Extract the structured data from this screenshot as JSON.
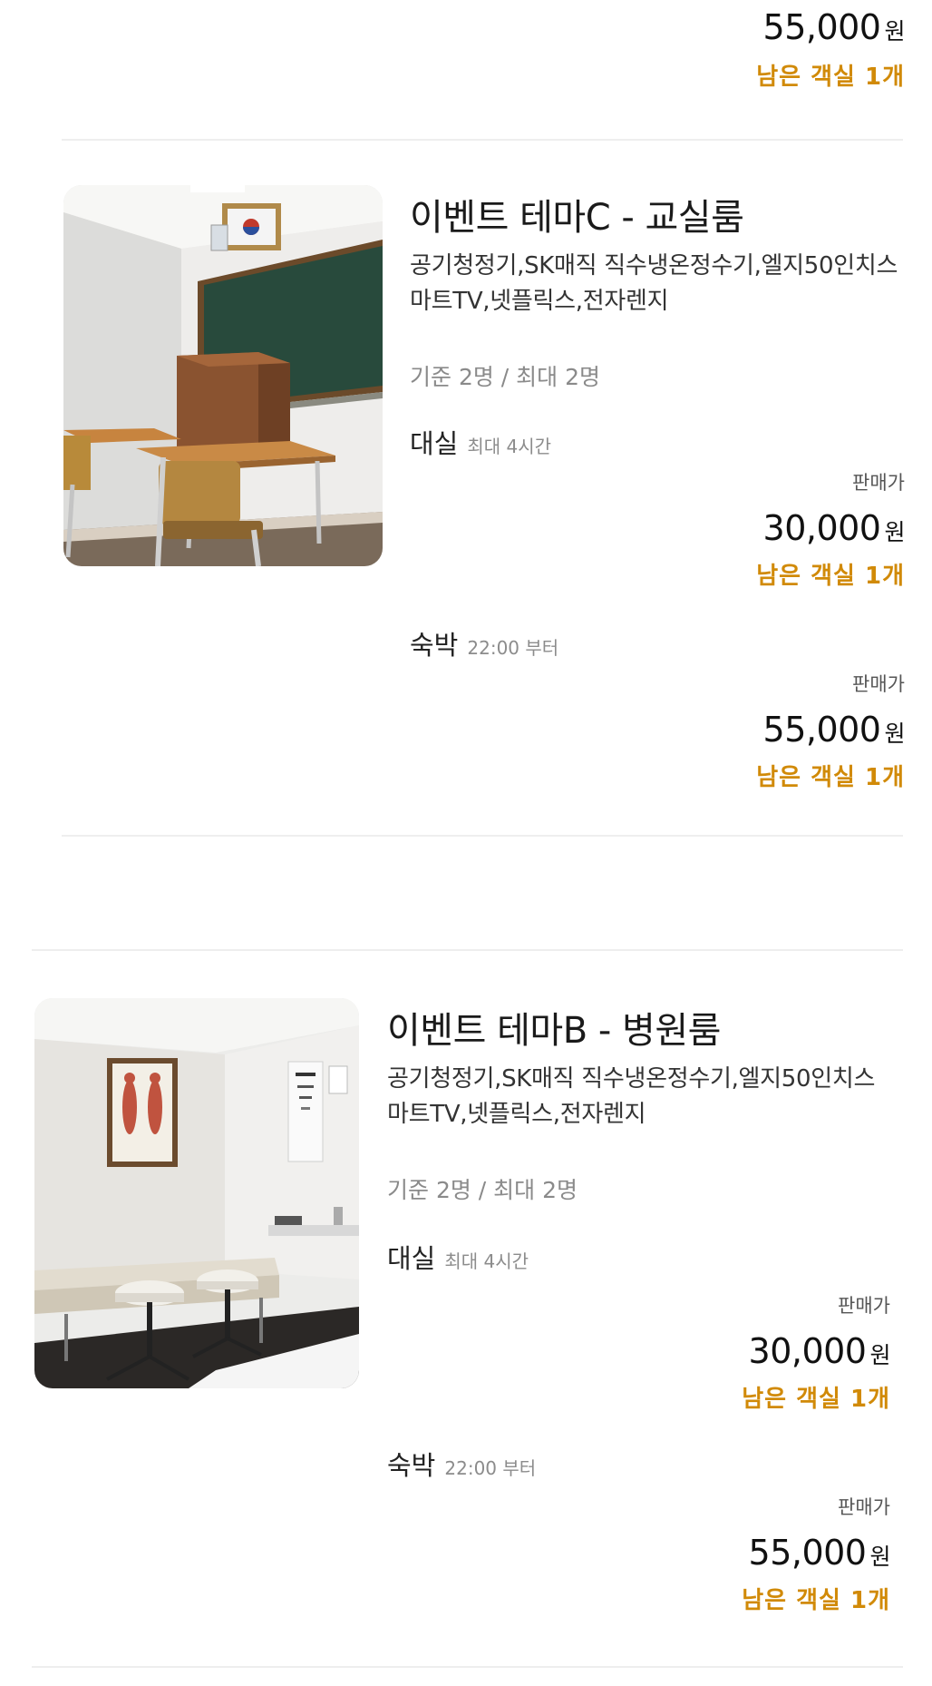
{
  "top_partial": {
    "price": "55,000",
    "currency": "원",
    "remaining": "남은 객실 1개"
  },
  "rooms": [
    {
      "title": "이벤트 테마C - 교실룸",
      "amenities": "공기청정기,SK매직 직수냉온정수기,엘지50인치스마트TV,넷플릭스,전자렌지",
      "capacity": "기준 2명 / 최대 2명",
      "rental": {
        "label": "대실",
        "sub": "최대 4시간",
        "sale_label": "판매가",
        "price": "30,000",
        "currency": "원",
        "remaining": "남은 객실 1개"
      },
      "stay": {
        "label": "숙박",
        "sub": "22:00 부터",
        "sale_label": "판매가",
        "price": "55,000",
        "currency": "원",
        "remaining": "남은 객실 1개"
      }
    },
    {
      "title": "이벤트 테마B - 병원룸",
      "amenities": "공기청정기,SK매직 직수냉온정수기,엘지50인치스마트TV,넷플릭스,전자렌지",
      "capacity": "기준 2명 / 최대 2명",
      "rental": {
        "label": "대실",
        "sub": "최대 4시간",
        "sale_label": "판매가",
        "price": "30,000",
        "currency": "원",
        "remaining": "남은 객실 1개"
      },
      "stay": {
        "label": "숙박",
        "sub": "22:00 부터",
        "sale_label": "판매가",
        "price": "55,000",
        "currency": "원",
        "remaining": "남은 객실 1개"
      }
    }
  ]
}
